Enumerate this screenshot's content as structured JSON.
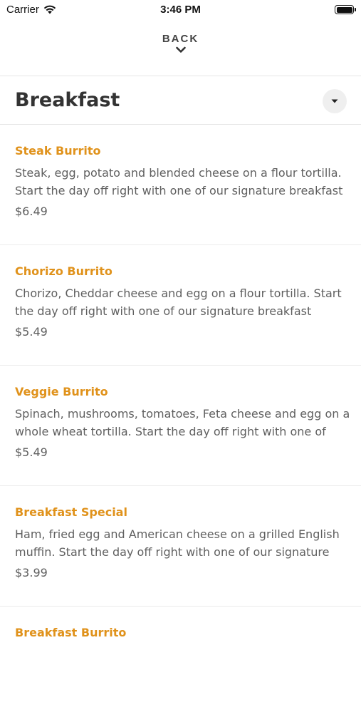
{
  "status_bar": {
    "carrier": "Carrier",
    "time": "3:46 PM"
  },
  "nav": {
    "back_label": "BACK"
  },
  "category": {
    "title": "Breakfast"
  },
  "colors": {
    "item_name": "#e0921b",
    "title": "#333333",
    "body_text": "#5f5f5f"
  },
  "items": [
    {
      "name": "Steak Burrito",
      "desc_lines": [
        "Steak, egg, potato and blended cheese on a flour tortilla.",
        "Start the day off right with one of our signature breakfast"
      ],
      "price": "$6.49"
    },
    {
      "name": "Chorizo Burrito",
      "desc_lines": [
        "Chorizo, Cheddar cheese and egg on a flour tortilla. Start",
        "the day off right with one of our signature breakfast"
      ],
      "price": "$5.49"
    },
    {
      "name": "Veggie Burrito",
      "desc_lines": [
        "Spinach, mushrooms, tomatoes, Feta cheese and egg on a",
        "whole wheat tortilla. Start the day off right with one of"
      ],
      "price": "$5.49"
    },
    {
      "name": "Breakfast Special",
      "desc_lines": [
        "Ham, fried egg and American cheese on a grilled English",
        "muffin. Start the day off right with one of our signature"
      ],
      "price": "$3.99"
    },
    {
      "name": "Breakfast Burrito",
      "desc_lines": [
        "",
        ""
      ],
      "price": ""
    }
  ]
}
